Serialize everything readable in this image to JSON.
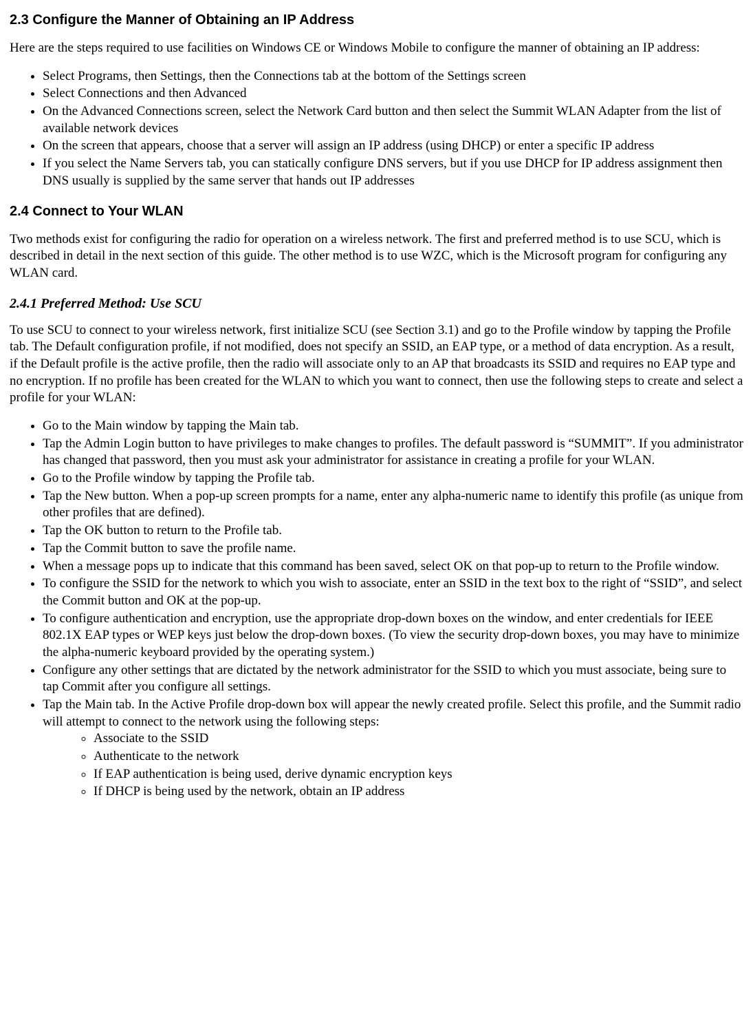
{
  "section23": {
    "heading": "2.3 Configure the Manner of Obtaining an IP Address",
    "intro": "Here are the steps required to use facilities on Windows CE or Windows Mobile to configure the manner of obtaining an IP address:",
    "items": [
      "Select Programs, then Settings, then the Connections tab at the bottom of the Settings screen",
      "Select Connections and then Advanced",
      "On the Advanced Connections screen, select the Network Card button and then select the Summit WLAN Adapter from the list of available network devices",
      "On the screen that appears, choose that a server will assign an IP address (using DHCP) or enter a specific IP address",
      "If you select the Name Servers tab, you can statically configure DNS servers, but if you use DHCP for IP address assignment then DNS usually is supplied by the same server that hands out IP addresses"
    ]
  },
  "section24": {
    "heading": "2.4 Connect to Your WLAN",
    "intro": "Two methods exist for configuring the radio for operation on a wireless network. The first and preferred method is to use SCU, which is described in detail in the next section of this guide. The other method is to use WZC, which is the Microsoft program for configuring any WLAN card."
  },
  "section241": {
    "heading": "2.4.1 Preferred Method: Use SCU",
    "intro": "To use SCU to connect to your wireless network, first initialize SCU (see Section 3.1) and go to the Profile window by tapping the Profile tab. The Default configuration profile, if not modified, does not specify an SSID, an EAP type, or a method of data encryption. As a result, if the Default profile is the active profile, then the radio will associate only to an AP that broadcasts its SSID and requires no EAP type and no encryption. If no profile has been created for the WLAN to which you want to connect, then use the following steps to create and select a profile for your WLAN:",
    "items": [
      "Go to the Main window by tapping the Main tab.",
      "Tap the Admin Login button to have privileges to make changes to profiles. The default password is “SUMMIT”. If you administrator has changed that password, then you must ask your administrator for assistance in creating a profile for your WLAN.",
      "Go to the Profile window by tapping the Profile tab.",
      "Tap the New button. When a pop-up screen prompts for a name, enter any alpha-numeric name to identify this profile (as unique from other profiles that are defined).",
      "Tap the OK button to return to the Profile tab.",
      "Tap the Commit button to save the profile name.",
      "When a message pops up to indicate that this command has been saved, select OK on that pop-up to return to the Profile window.",
      "To configure the SSID for the network to which you wish to associate, enter an SSID in the text box to the right of “SSID”, and select the Commit button and OK at the pop-up.",
      "To configure authentication and encryption, use the appropriate drop-down boxes on the window, and enter credentials for IEEE 802.1X EAP types or WEP keys just below the drop-down boxes. (To view the security drop-down boxes, you may have to minimize the alpha-numeric keyboard provided by the operating system.)",
      "Configure any other settings that are dictated by the network administrator for the SSID to which you must associate, being sure to tap Commit after you configure all settings.",
      "Tap the Main tab. In the Active Profile drop-down box will appear the newly created profile. Select this profile, and the Summit radio will attempt to connect to the network using the following steps:"
    ],
    "subitems": [
      "Associate to the SSID",
      "Authenticate to the network",
      "If EAP authentication is being used, derive dynamic encryption keys",
      "If DHCP is being used by the network, obtain an IP address"
    ]
  }
}
